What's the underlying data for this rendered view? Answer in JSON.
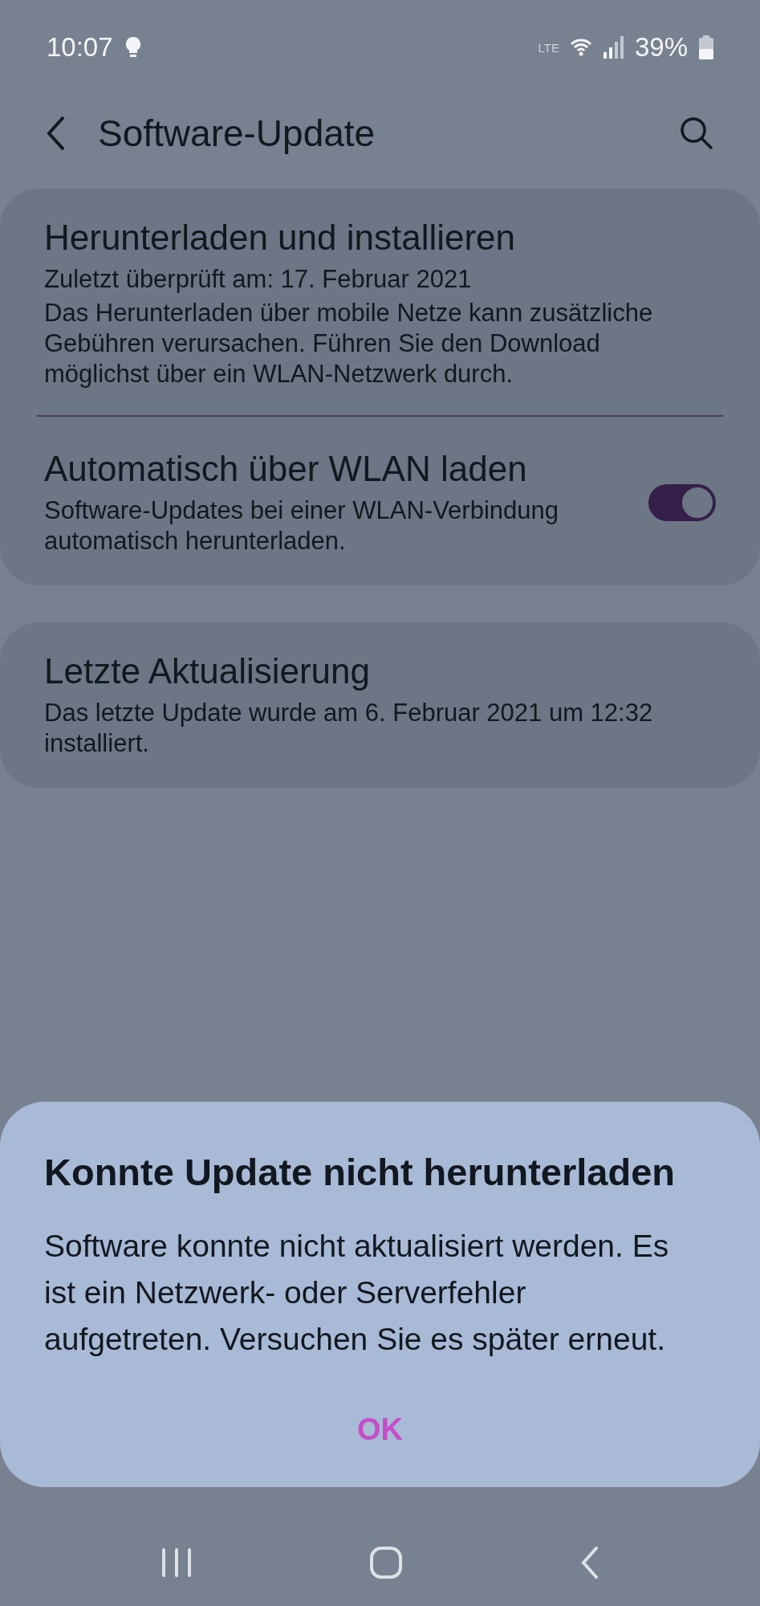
{
  "status_bar": {
    "time": "10:07",
    "network": "LTE",
    "battery": "39%"
  },
  "header": {
    "title": "Software-Update"
  },
  "cards": [
    {
      "items": [
        {
          "kind": "text",
          "title": "Herunterladen und installieren",
          "lines": [
            "Zuletzt überprüft am: 17. Februar 2021",
            "Das Herunterladen über mobile Netze kann zusätzliche\nGebühren verursachen. Führen Sie den Download\nmöglichst über ein WLAN-Netzwerk durch."
          ]
        },
        {
          "kind": "switch",
          "title": "Automatisch über WLAN laden",
          "lines": [
            "Software-Updates bei einer WLAN-Verbindung\nautomatisch herunterladen."
          ],
          "on": true
        }
      ]
    },
    {
      "items": [
        {
          "kind": "text",
          "title": "Letzte Aktualisierung",
          "lines": [
            "Das letzte Update wurde am 6. Februar 2021 um 12:32\ninstalliert."
          ]
        }
      ]
    }
  ],
  "dialog": {
    "title": "Konnte Update nicht herunterladen",
    "message": "Software konnte nicht aktualisiert werden. Es\nist ein Netzwerk- oder Serverfehler\naufgetreten. Versuchen Sie es später erneut.",
    "buttons": [
      "OK"
    ]
  }
}
